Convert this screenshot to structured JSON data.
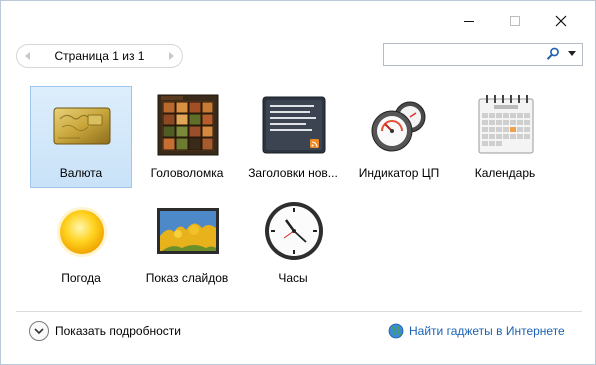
{
  "window": {
    "controls": {
      "minimize": "minimize",
      "maximize": "maximize",
      "close": "close"
    }
  },
  "pager": {
    "text": "Страница 1 из 1"
  },
  "search": {
    "value": "",
    "placeholder": ""
  },
  "gadgets": [
    {
      "label": "Валюта",
      "icon": "currency-icon",
      "selected": true
    },
    {
      "label": "Головоломка",
      "icon": "puzzle-icon",
      "selected": false
    },
    {
      "label": "Заголовки нов...",
      "icon": "feed-headlines-icon",
      "selected": false
    },
    {
      "label": "Индикатор ЦП",
      "icon": "cpu-meter-icon",
      "selected": false
    },
    {
      "label": "Календарь",
      "icon": "calendar-icon",
      "selected": false
    },
    {
      "label": "Погода",
      "icon": "weather-sun-icon",
      "selected": false
    },
    {
      "label": "Показ слайдов",
      "icon": "slideshow-icon",
      "selected": false
    },
    {
      "label": "Часы",
      "icon": "clock-icon",
      "selected": false
    }
  ],
  "footer": {
    "details_label": "Показать подробности",
    "online_label": "Найти гаджеты в Интернете"
  },
  "colors": {
    "accent_link": "#1a63b4",
    "selection_bg": "#c9e2f8",
    "selection_border": "#9fc7ee"
  }
}
